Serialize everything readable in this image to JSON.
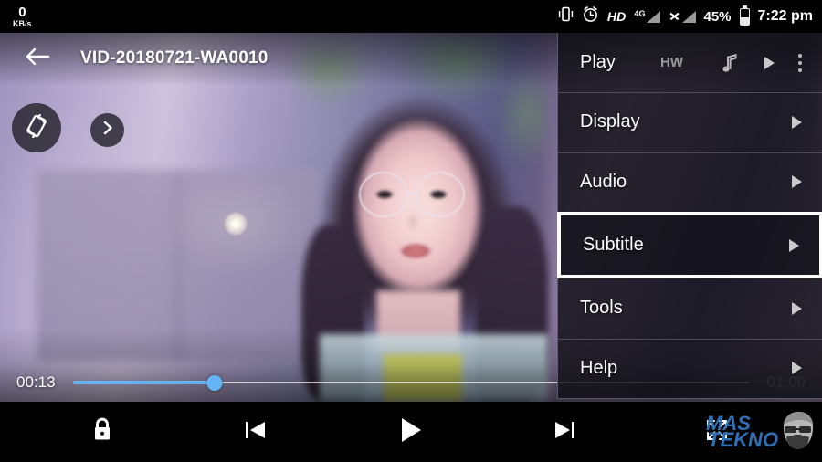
{
  "status_bar": {
    "net_speed_value": "0",
    "net_speed_unit": "KB/s",
    "vibrate_icon": "vibrate-icon",
    "alarm_icon": "alarm-clock-icon",
    "hd_label": "HD",
    "network_label": "4G",
    "signal_icon": "signal-bars-icon",
    "no_sim_icon": "no-signal-x-icon",
    "battery_percent": "45%",
    "battery_icon": "battery-icon",
    "clock": "7:22 pm"
  },
  "title_bar": {
    "back_icon": "back-arrow-icon",
    "title": "VID-20180721-WA0010"
  },
  "overlay_buttons": {
    "rotate_icon": "screen-rotation-icon",
    "expand_icon": "chevron-right-icon"
  },
  "seek": {
    "current_time": "00:13",
    "total_time": "01:00",
    "progress_percent": 21,
    "fill_color": "#64b5f6",
    "rail_color": "#ffffff"
  },
  "controls": {
    "lock_label": "lock-icon",
    "previous_label": "previous-track-icon",
    "play_label": "play-icon",
    "next_label": "next-track-icon",
    "fullscreen_label": "fullscreen-expand-icon"
  },
  "watermark": {
    "line1": "MAS",
    "line2": "TEKNO",
    "color": "#2f6fb5",
    "face_icon": "bearded-face-logo"
  },
  "options_menu": {
    "highlight_color": "#ffffff",
    "items": [
      {
        "label": "Play",
        "badge": "HW",
        "has_arrow": true,
        "has_note_icon": true,
        "has_overflow": true,
        "selected": false
      },
      {
        "label": "Display",
        "badge": "",
        "has_arrow": true,
        "has_note_icon": false,
        "has_overflow": false,
        "selected": false
      },
      {
        "label": "Audio",
        "badge": "",
        "has_arrow": true,
        "has_note_icon": false,
        "has_overflow": false,
        "selected": false
      },
      {
        "label": "Subtitle",
        "badge": "",
        "has_arrow": true,
        "has_note_icon": false,
        "has_overflow": false,
        "selected": true
      },
      {
        "label": "Tools",
        "badge": "",
        "has_arrow": true,
        "has_note_icon": false,
        "has_overflow": false,
        "selected": false
      },
      {
        "label": "Help",
        "badge": "",
        "has_arrow": true,
        "has_note_icon": false,
        "has_overflow": false,
        "selected": false
      }
    ]
  }
}
